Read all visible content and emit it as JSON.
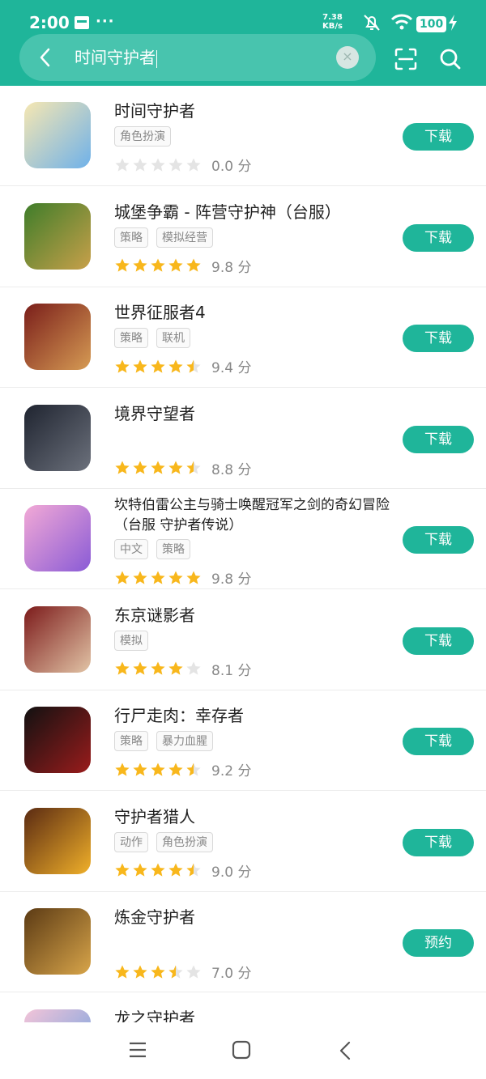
{
  "status": {
    "time": "2:00",
    "dots": "···",
    "speed_value": "7.38",
    "speed_unit": "KB/s",
    "battery": "100"
  },
  "search": {
    "query": "时间守护者"
  },
  "rating_unit": "分",
  "apps": [
    {
      "name": "时间守护者",
      "tags": [
        "角色扮演"
      ],
      "score": "0.0",
      "stars": 0,
      "button": "下载",
      "icon_colors": [
        "#f6e7b2",
        "#6fb1e9"
      ]
    },
    {
      "name": "城堡争霸 - 阵营守护神（台服）",
      "tags": [
        "策略",
        "模拟经营"
      ],
      "score": "9.8",
      "stars": 5,
      "button": "下载",
      "icon_colors": [
        "#3f7d2a",
        "#c8a04a"
      ]
    },
    {
      "name": "世界征服者4",
      "tags": [
        "策略",
        "联机"
      ],
      "score": "9.4",
      "stars": 4.5,
      "button": "下载",
      "icon_colors": [
        "#7a1e1a",
        "#d69b54"
      ]
    },
    {
      "name": "境界守望者",
      "tags": [],
      "score": "8.8",
      "stars": 4.5,
      "button": "下载",
      "icon_colors": [
        "#1f2430",
        "#6c717c"
      ]
    },
    {
      "name": "坎特伯雷公主与骑士唤醒冠军之剑的奇幻冒险（台服 守护者传说）",
      "tags": [
        "中文",
        "策略"
      ],
      "score": "9.8",
      "stars": 5,
      "button": "下载",
      "icon_colors": [
        "#f2a9d6",
        "#8a5bd6"
      ]
    },
    {
      "name": "东京谜影者",
      "tags": [
        "模拟"
      ],
      "score": "8.1",
      "stars": 4,
      "button": "下载",
      "icon_colors": [
        "#7c1b1b",
        "#e2c4a6"
      ]
    },
    {
      "name": "行尸走肉：幸存者",
      "tags": [
        "策略",
        "暴力血腥"
      ],
      "score": "9.2",
      "stars": 4.5,
      "button": "下载",
      "icon_colors": [
        "#111111",
        "#9a1c1c"
      ]
    },
    {
      "name": "守护者猎人",
      "tags": [
        "动作",
        "角色扮演"
      ],
      "score": "9.0",
      "stars": 4.5,
      "button": "下载",
      "icon_colors": [
        "#5a2a12",
        "#f0b02a"
      ]
    },
    {
      "name": "炼金守护者",
      "tags": [],
      "score": "7.0",
      "stars": 3.5,
      "button": "预约",
      "icon_colors": [
        "#5b3a14",
        "#d8a54a"
      ]
    },
    {
      "name": "龙之守护者",
      "tags": [],
      "score": "",
      "stars": 0,
      "button": "",
      "icon_colors": [
        "#f3c4d8",
        "#6aa0e0"
      ]
    }
  ],
  "colors": {
    "accent": "#1fb59a",
    "star_on": "#f8b71c",
    "star_off": "#e4e4e4"
  }
}
